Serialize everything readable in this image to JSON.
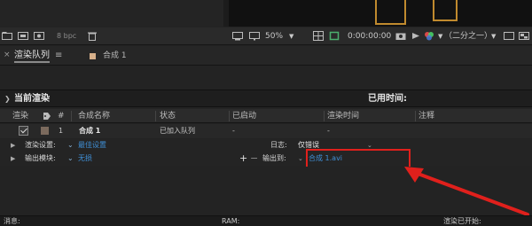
{
  "toolbar": {
    "bpc": "8 bpc",
    "zoom": "50%",
    "timecode": "0:00:00:00",
    "resolution": "（二分之一）"
  },
  "tabs": {
    "active": "渲染队列",
    "menu": "≡",
    "comp": "合成 1",
    "close": "×"
  },
  "current_render": {
    "label": "当前渲染",
    "elapsed": "已用时间:"
  },
  "columns": {
    "render": "渲染",
    "number": "#",
    "comp_name": "合成名称",
    "status": "状态",
    "started": "已启动",
    "render_time": "渲染时间",
    "comment": "注释"
  },
  "queue": [
    {
      "number": "1",
      "comp_name": "合成 1",
      "status": "已加入队列",
      "started": "-",
      "render_time": "-"
    }
  ],
  "render_settings": {
    "label": "渲染设置:",
    "value": "最佳设置",
    "log_label": "日志:",
    "log_value": "仅错误"
  },
  "output_module": {
    "label": "输出模块:",
    "value": "无损",
    "output_to_label": "输出到:",
    "output_file": "合成 1.avi"
  },
  "status_bar": {
    "message": "消息:",
    "ram": "RAM:",
    "render_started": "渲染已开始:"
  },
  "colors": {
    "highlight": "#e0201c",
    "link": "#3f8fd6",
    "guide": "#c08a2e"
  }
}
